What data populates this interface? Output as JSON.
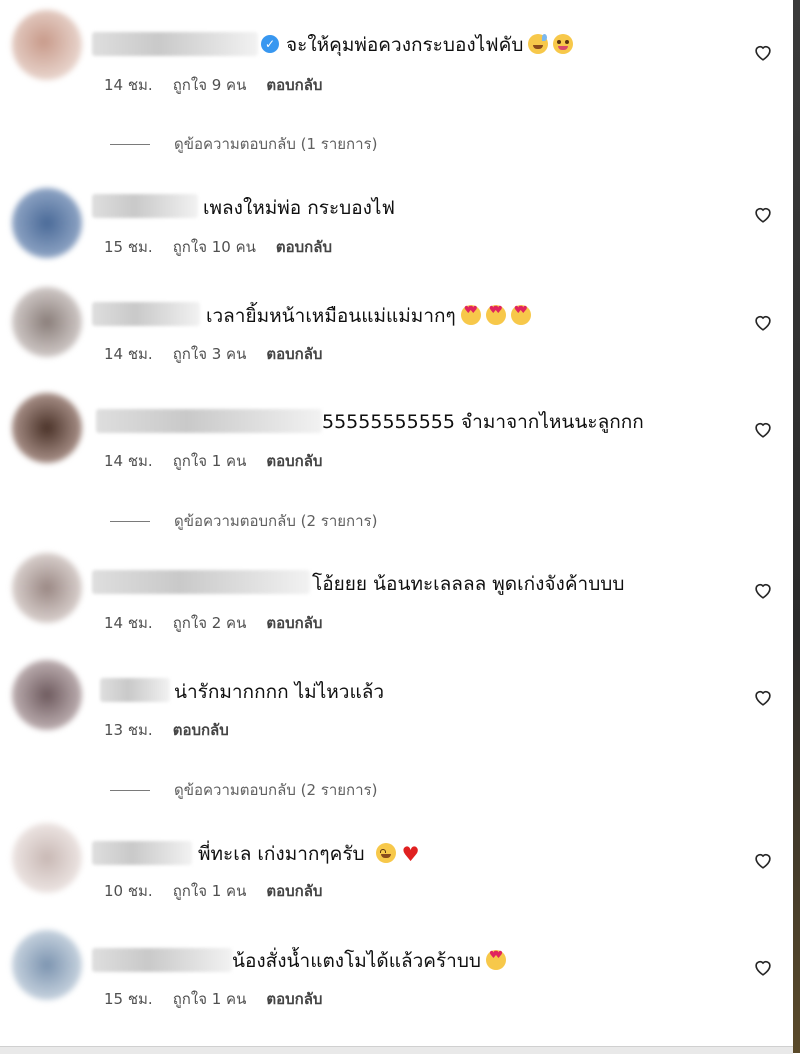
{
  "comments": [
    {
      "text": "จะให้คุมพ่อควงกระบองไฟคับ",
      "time": "14 ชม.",
      "likes": "ถูกใจ 9 คน",
      "reply": "ตอบกลับ",
      "view_replies": "ดูข้อความตอบกลับ (1 รายการ)"
    },
    {
      "text": "เพลงใหม่พ่อ กระบองไฟ",
      "time": "15 ชม.",
      "likes": "ถูกใจ 10 คน",
      "reply": "ตอบกลับ"
    },
    {
      "text": "เวลายิ้มหน้าเหมือนแม่แม่มากๆ",
      "time": "14 ชม.",
      "likes": "ถูกใจ 3 คน",
      "reply": "ตอบกลับ"
    },
    {
      "text": "55555555555 จำมาจากไหนนะลูกกก",
      "time": "14 ชม.",
      "likes": "ถูกใจ 1 คน",
      "reply": "ตอบกลับ",
      "view_replies": "ดูข้อความตอบกลับ (2 รายการ)"
    },
    {
      "text": "โอ้ยยย น้อนทะเลลลล พูดเก่งจังค้าบบบ",
      "time": "14 ชม.",
      "likes": "ถูกใจ 2 คน",
      "reply": "ตอบกลับ"
    },
    {
      "text": "น่ารักมากกกก ไม่ไหวแล้ว",
      "time": "13 ชม.",
      "reply": "ตอบกลับ",
      "view_replies": "ดูข้อความตอบกลับ (2 รายการ)"
    },
    {
      "text": "พี่ทะเล เก่งมากๆครับ",
      "time": "10 ชม.",
      "likes": "ถูกใจ 1 คน",
      "reply": "ตอบกลับ"
    },
    {
      "text": "น้องสั่งน้ำแตงโมได้แล้วคร้าบบ",
      "time": "15 ชม.",
      "likes": "ถูกใจ 1 คน",
      "reply": "ตอบกลับ"
    }
  ],
  "icons": {
    "like": "heart-outline-icon",
    "verified": "verified-badge-icon"
  },
  "colors": {
    "verified": "#3897f0",
    "text": "#0f0f0f",
    "meta": "#505050"
  }
}
